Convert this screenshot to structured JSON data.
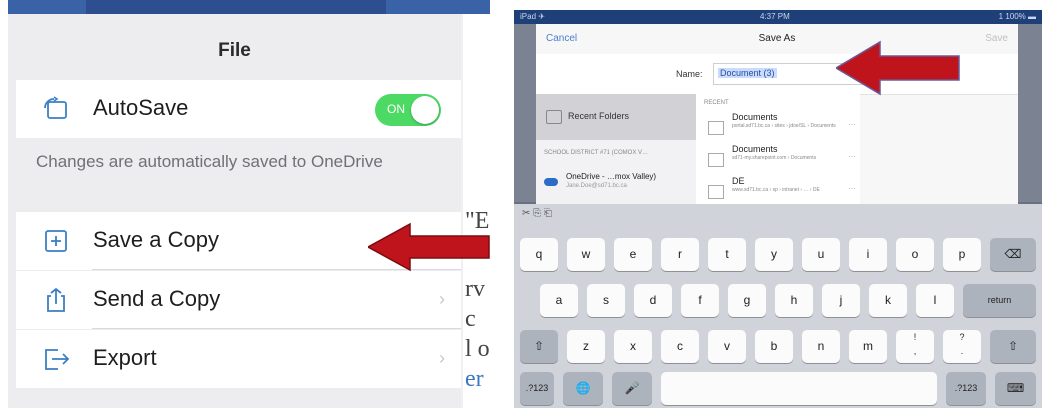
{
  "file_menu": {
    "title": "File",
    "autosave_label": "AutoSave",
    "toggle_text": "ON",
    "note": "Changes are automatically saved to OneDrive",
    "items": [
      {
        "label": "Save a Copy",
        "icon": "save-copy-icon"
      },
      {
        "label": "Send a Copy",
        "icon": "share-icon"
      },
      {
        "label": "Export",
        "icon": "export-icon"
      }
    ],
    "chevron": "›"
  },
  "background_doc": {
    "frag1": "\"E",
    "frag2": "rv",
    "frag3": "c",
    "frag4": "l o",
    "frag5": "er"
  },
  "save_as": {
    "status_left": "iPad ✈",
    "status_time": "4:37 PM",
    "status_right": "1 100% ▬",
    "cancel": "Cancel",
    "title": "Save As",
    "save": "Save",
    "name_label": "Name:",
    "name_value": "Document (3)",
    "recent_folders": "Recent Folders",
    "district": "SCHOOL DISTRICT #71 (COMOX V…",
    "onedrive_name": "OneDrive - …mox Valley)",
    "onedrive_email": "Jane.Doe@sd71.bc.ca",
    "recent_header": "RECENT",
    "recent_items": [
      {
        "name": "Documents",
        "path": "portal.sd71.bc.ca › sites › jdoe/SL › Documents"
      },
      {
        "name": "Documents",
        "path": "sd71-my.sharepoint.com › Documents"
      },
      {
        "name": "DE",
        "path": "www.sd71.bc.ca › sp › intranet › … › DE"
      }
    ],
    "more": "···"
  },
  "keyboard": {
    "tools": "✂  ⎘  ⎗",
    "row1": [
      "q",
      "w",
      "e",
      "r",
      "t",
      "y",
      "u",
      "i",
      "o",
      "p"
    ],
    "backspace": "⌫",
    "row2": [
      "a",
      "s",
      "d",
      "f",
      "g",
      "h",
      "j",
      "k",
      "l"
    ],
    "return": "return",
    "row3": [
      "z",
      "x",
      "c",
      "v",
      "b",
      "n",
      "m",
      "!\n,",
      "?\n."
    ],
    "shift": "⇧",
    "num_left": ".?123",
    "globe": "🌐",
    "mic": "🎤",
    "space": "",
    "num_right": ".?123",
    "hide": "⌨"
  },
  "colors": {
    "accent": "#4a7fd1",
    "toggle": "#4cd964",
    "arrow": "#c0141c"
  }
}
